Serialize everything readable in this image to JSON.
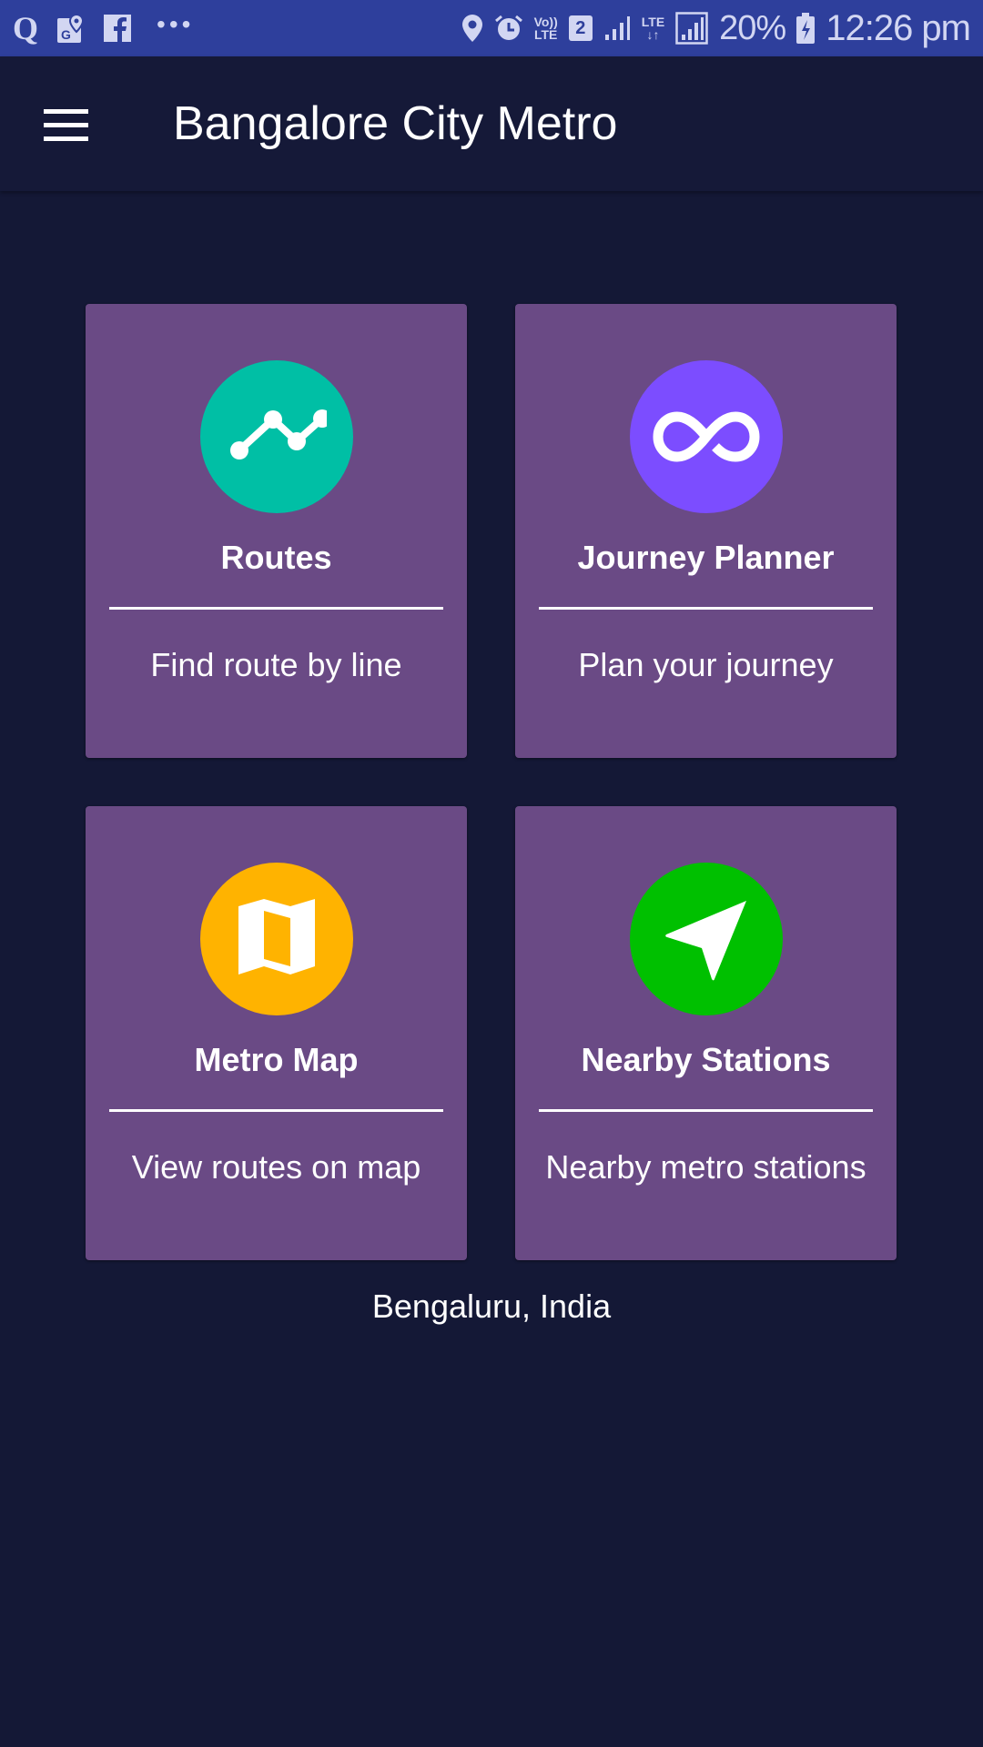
{
  "status_bar": {
    "left_icons": [
      "quora-icon",
      "google-maps-icon",
      "facebook-icon",
      "more-notifications-icon"
    ],
    "right_icons": [
      "location-icon",
      "alarm-icon",
      "volte-icon",
      "sim2-icon",
      "signal-icon",
      "lte-data-icon",
      "signal-icon-2",
      "battery-charging-icon"
    ],
    "volte_label_top": "Vo))",
    "volte_label_bottom": "LTE",
    "sim_label": "2",
    "lte_label": "LTE",
    "battery": "20%",
    "time": "12:26 pm"
  },
  "appbar": {
    "title": "Bangalore City Metro",
    "menu_icon": "hamburger-menu-icon"
  },
  "cards": [
    {
      "title": "Routes",
      "subtitle": "Find route by line",
      "icon": "route-line-icon",
      "color": "#00bfa5"
    },
    {
      "title": "Journey Planner",
      "subtitle": "Plan your journey",
      "icon": "infinity-icon",
      "color": "#7c4dff"
    },
    {
      "title": "Metro Map",
      "subtitle": "View routes on map",
      "icon": "map-icon",
      "color": "#ffb300"
    },
    {
      "title": "Nearby Stations",
      "subtitle": "Nearby metro stations",
      "icon": "navigation-arrow-icon",
      "color": "#00c000"
    }
  ],
  "footer": {
    "location": "Bengaluru, India"
  },
  "colors": {
    "status_bar": "#2e3f9c",
    "background": "#141836",
    "card": "#6a4a85"
  }
}
